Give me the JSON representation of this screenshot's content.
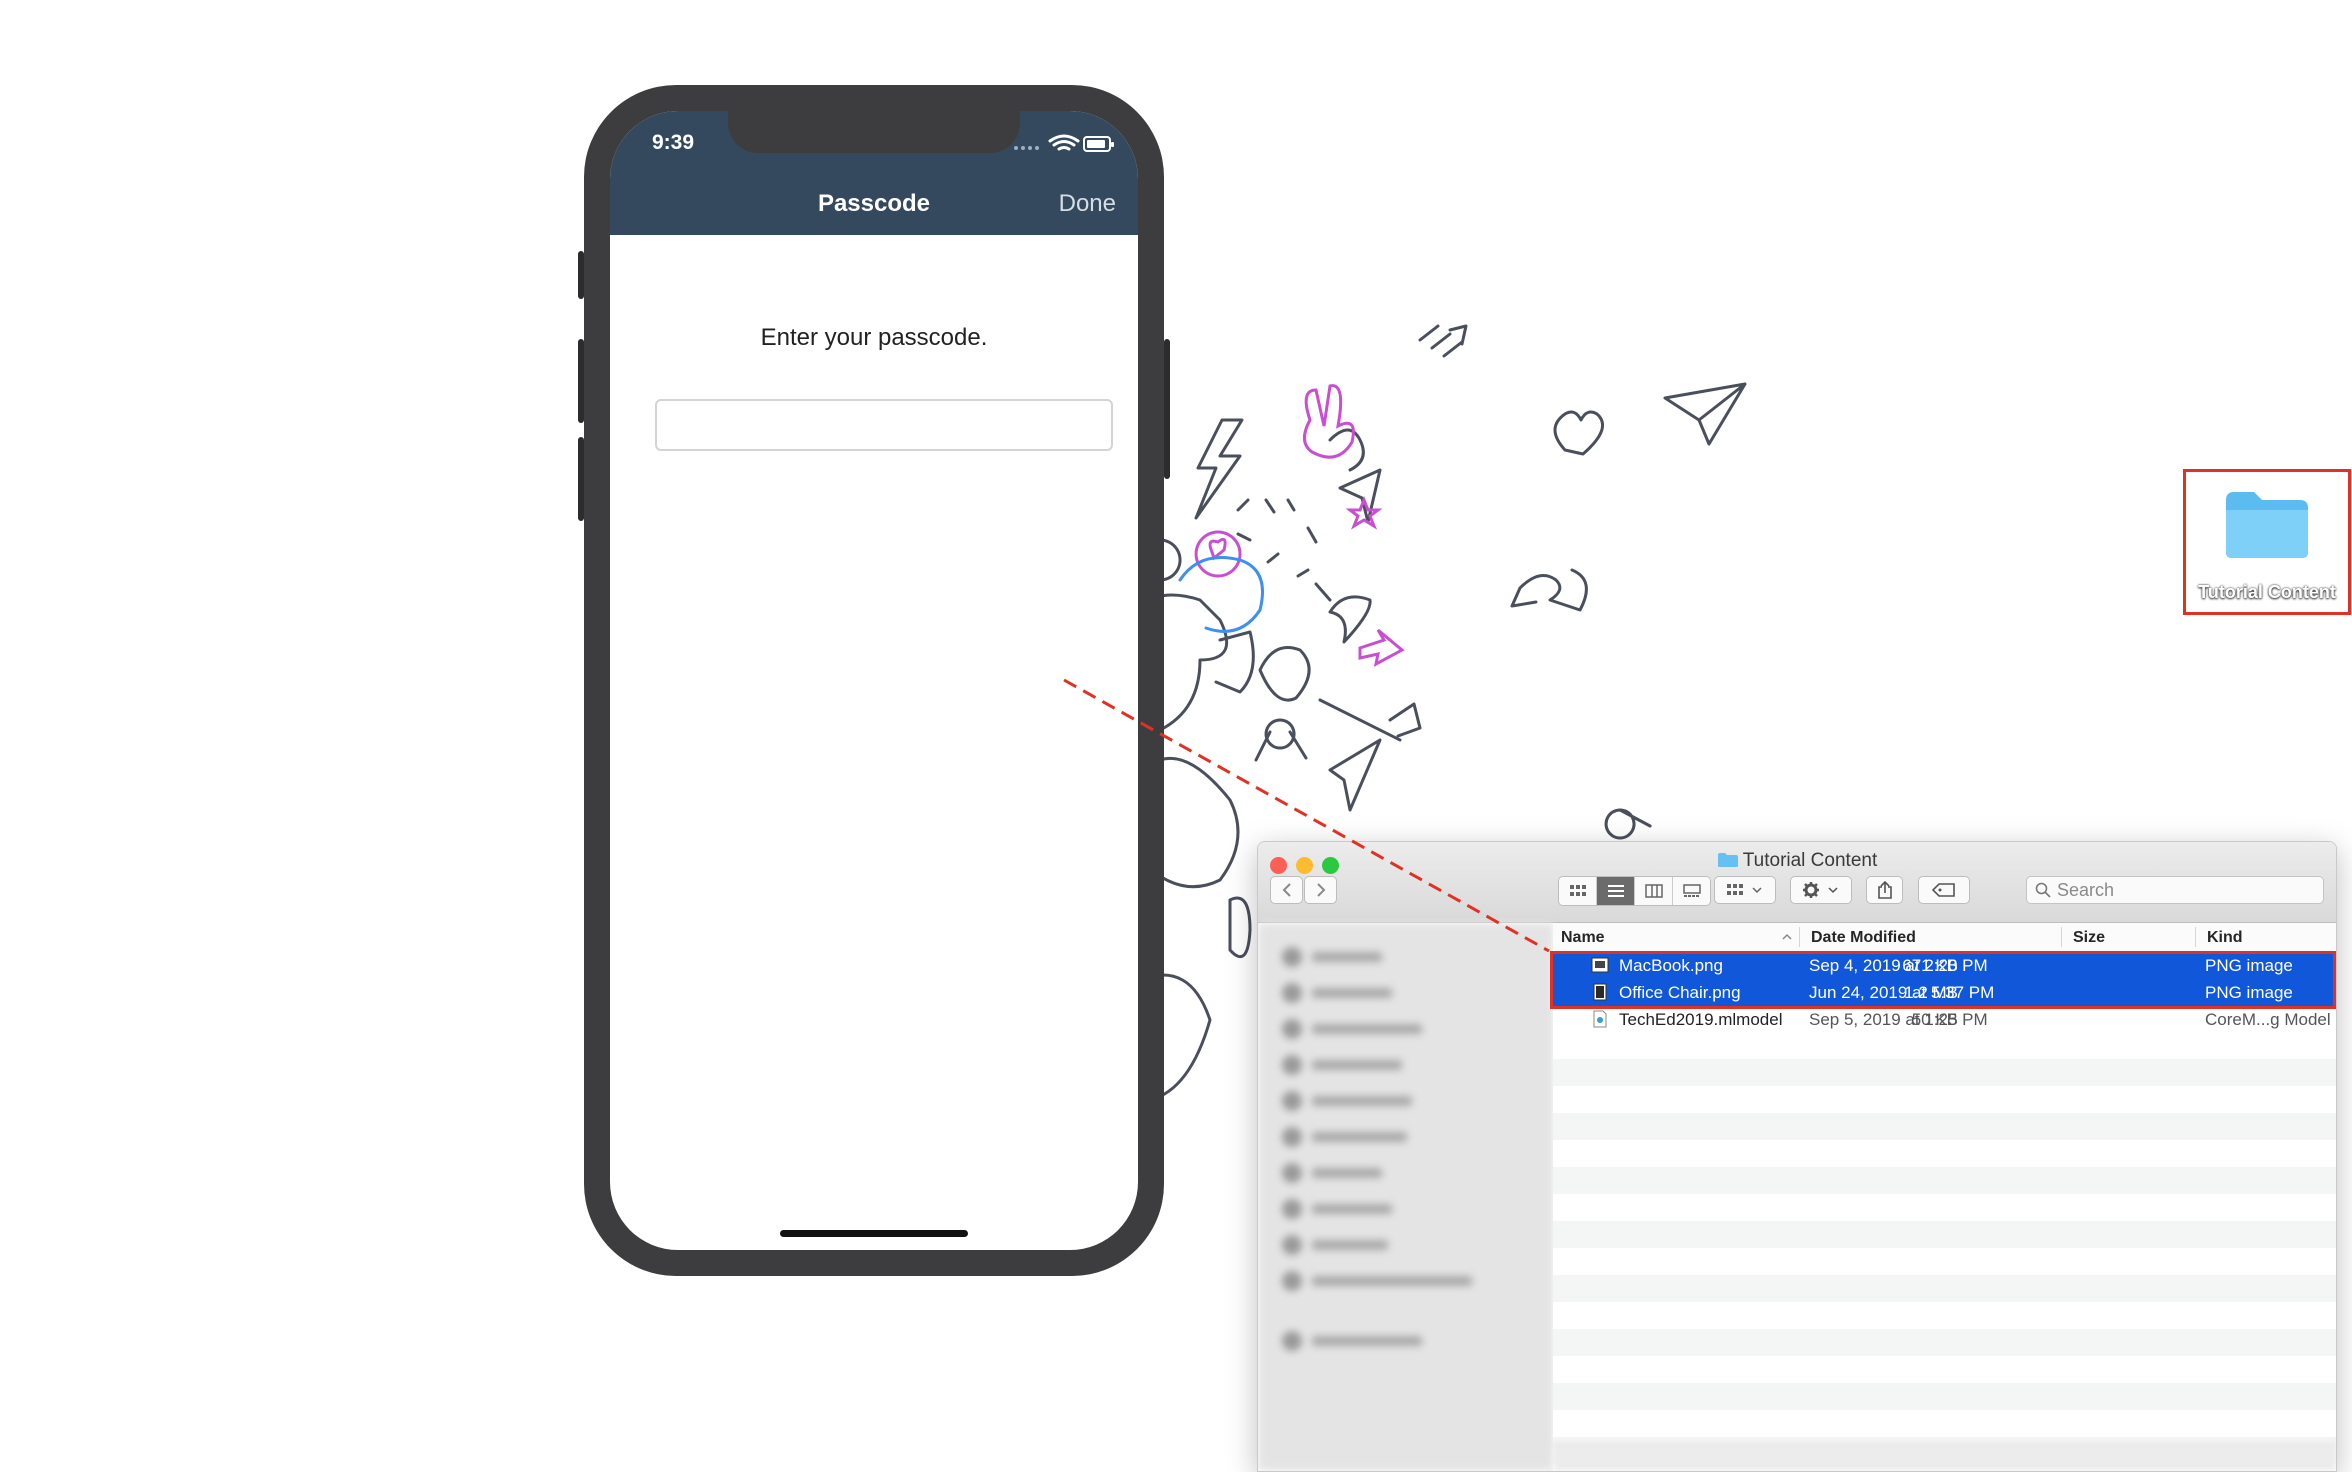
{
  "phone": {
    "status_time": "9:39",
    "nav_title": "Passcode",
    "nav_done": "Done",
    "prompt": "Enter your passcode.",
    "passcode_value": "",
    "nav_color": "#35495e"
  },
  "desktop": {
    "folder_label": "Tutorial Content",
    "folder_icon": "folder-icon"
  },
  "finder": {
    "window_title": "Tutorial Content",
    "search_placeholder": "Search",
    "columns": {
      "name": "Name",
      "date": "Date Modified",
      "size": "Size",
      "kind": "Kind"
    },
    "files": [
      {
        "name": "MacBook.png",
        "date": "Sep 4, 2019 at 2:20 PM",
        "size": "671 KB",
        "kind": "PNG image",
        "selected": true
      },
      {
        "name": "Office Chair.png",
        "date": "Jun 24, 2019 at 5:37 PM",
        "size": "1.2 MB",
        "kind": "PNG image",
        "selected": true
      },
      {
        "name": "TechEd2019.mlmodel",
        "date": "Sep 5, 2019 at 1:25 PM",
        "size": "50 KB",
        "kind": "CoreM...g Model",
        "selected": false
      }
    ],
    "selection_color": "#1157d9",
    "highlight_color": "#e03224"
  }
}
